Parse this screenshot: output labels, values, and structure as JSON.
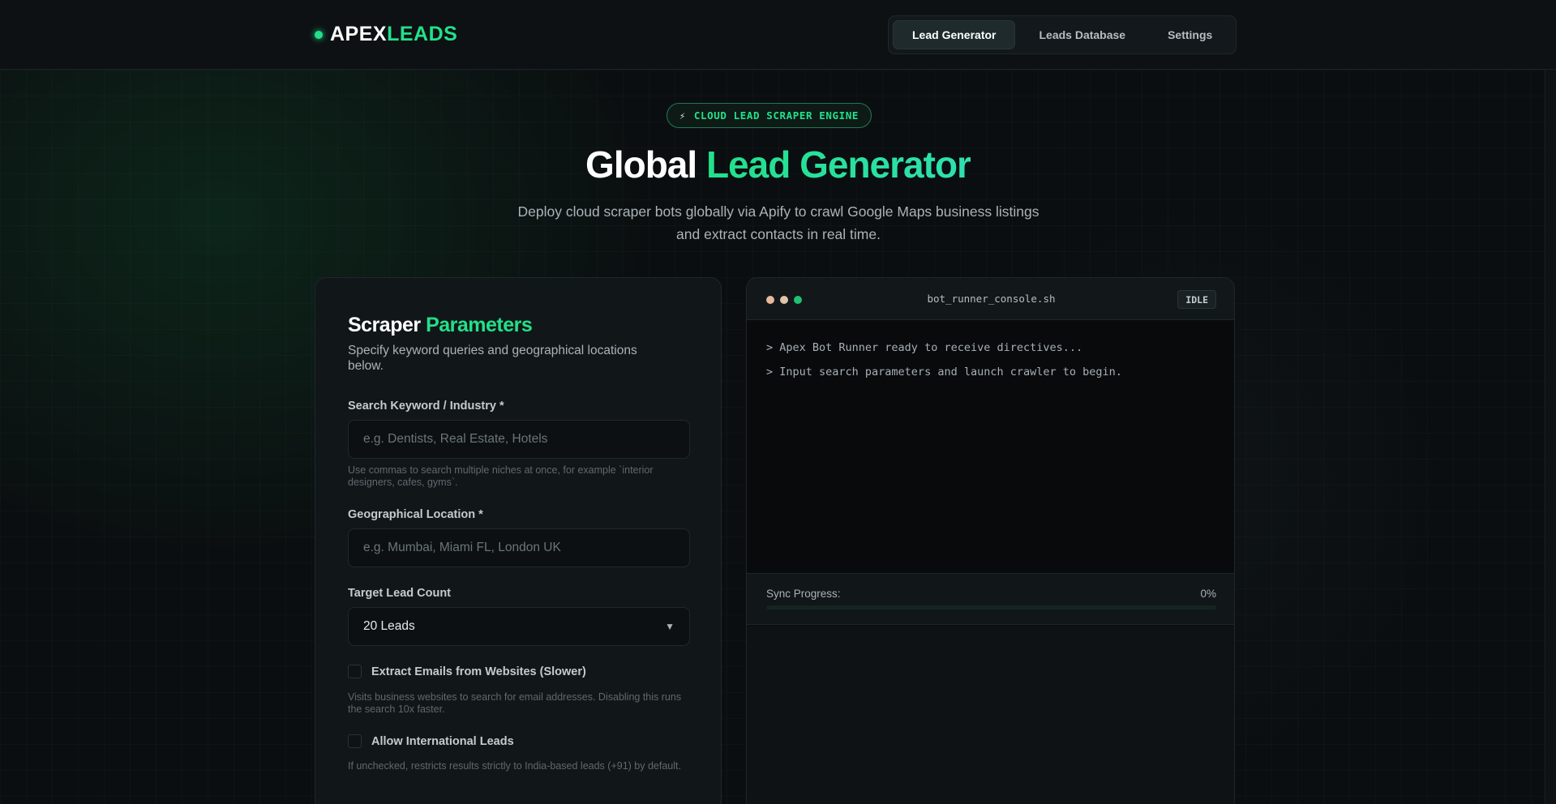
{
  "header": {
    "logo_part1": "APEX",
    "logo_part2": "LEADS",
    "nav": [
      {
        "label": "Lead Generator",
        "active": true
      },
      {
        "label": "Leads Database",
        "active": false
      },
      {
        "label": "Settings",
        "active": false
      }
    ]
  },
  "hero": {
    "badge": "CLOUD LEAD SCRAPER ENGINE",
    "title_part1": "Global",
    "title_part2": "Lead Generator",
    "subtitle": "Deploy cloud scraper bots globally via Apify to crawl Google Maps business listings and extract contacts in real time."
  },
  "form": {
    "title_part1": "Scraper",
    "title_part2": "Parameters",
    "subtitle": "Specify keyword queries and geographical locations below.",
    "keyword_label": "Search Keyword / Industry *",
    "keyword_placeholder": "e.g. Dentists, Real Estate, Hotels",
    "keyword_hint": "Use commas to search multiple niches at once, for example `interior designers, cafes, gyms`.",
    "location_label": "Geographical Location *",
    "location_placeholder": "e.g. Mumbai, Miami FL, London UK",
    "count_label": "Target Lead Count",
    "count_value": "20 Leads",
    "extract_emails_label": "Extract Emails from Websites (Slower)",
    "extract_emails_hint": "Visits business websites to search for email addresses. Disabling this runs the search 10x faster.",
    "international_label": "Allow International Leads",
    "international_hint": "If unchecked, restricts results strictly to India-based leads (+91) by default."
  },
  "console": {
    "filename": "bot_runner_console.sh",
    "status": "IDLE",
    "lines": [
      "> Apex Bot Runner ready to receive directives...",
      "> Input search parameters and launch crawler to begin."
    ],
    "progress_label": "Sync Progress:",
    "progress_text": "0%",
    "progress_fraction": 0
  },
  "colors": {
    "accent": "#22e08a",
    "dot_1": "#e8b89a",
    "dot_2": "#e0c3a8",
    "dot_3": "#1fbf74"
  },
  "icons": {
    "badge_icon": "lightning-icon",
    "select_icon": "caret-down-icon"
  }
}
